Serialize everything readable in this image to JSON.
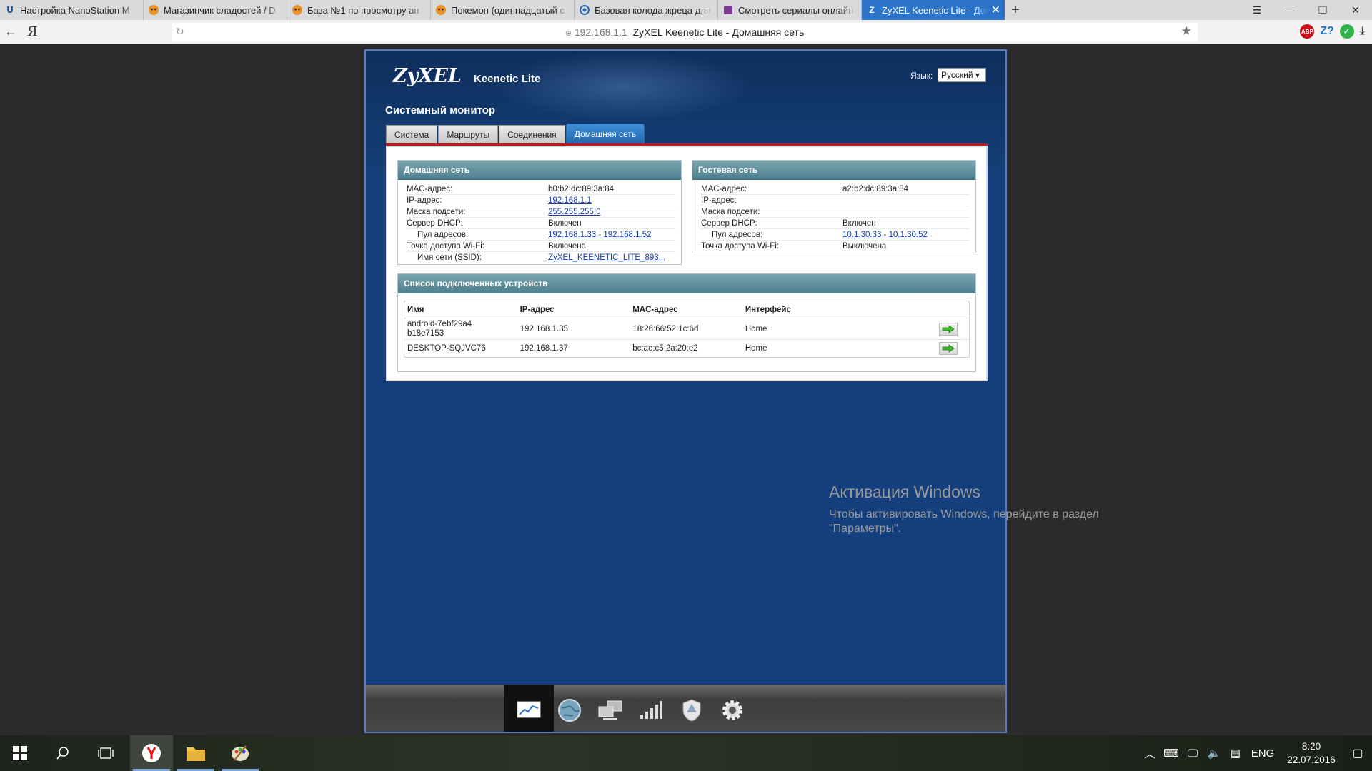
{
  "browser": {
    "tabs": [
      {
        "title": "Настройка NanoStation M",
        "favicon": "U"
      },
      {
        "title": "Магазинчик сладостей / D",
        "favicon": "tiger-icon"
      },
      {
        "title": "База №1 по просмотру ан",
        "favicon": "tiger-icon"
      },
      {
        "title": "Покемон (одиннадцатый с",
        "favicon": "tiger-icon"
      },
      {
        "title": "Базовая колода жреца для",
        "favicon": "swirl-icon"
      },
      {
        "title": "Смотреть сериалы онлайн",
        "favicon": "purple-icon"
      },
      {
        "title": "ZyXEL Keenetic Lite - Дом",
        "favicon": "Z"
      }
    ],
    "back_label": "←",
    "yandex_label": "Я",
    "url_host": "192.168.1.1",
    "url_title": "ZyXEL Keenetic Lite - Домашняя сеть",
    "ext_abp": "ABP",
    "ext_z": "Z?",
    "ext_ok": "✓"
  },
  "router": {
    "logo": "ZyXEL",
    "model": "Keenetic Lite",
    "lang_label": "Язык:",
    "lang_value": "Русский ▾",
    "page_title": "Системный монитор",
    "tabs": [
      "Система",
      "Маршруты",
      "Соединения",
      "Домашняя сеть"
    ],
    "active_tab": "Домашняя сеть",
    "home_net": {
      "title": "Домашняя сеть",
      "rows": [
        {
          "k": "MAC-адрес:",
          "v": "b0:b2:dc:89:3a:84"
        },
        {
          "k": "IP-адрес:",
          "v": "192.168.1.1"
        },
        {
          "k": "Маска подсети:",
          "v": "255.255.255.0"
        },
        {
          "k": "Сервер DHCP:",
          "v": "Включен"
        },
        {
          "k": "Пул адресов:",
          "v": "192.168.1.33 - 192.168.1.52"
        },
        {
          "k": "Точка доступа Wi-Fi:",
          "v": "Включена"
        },
        {
          "k": "Имя сети (SSID):",
          "v": "ZyXEL_KEENETIC_LITE_893..."
        }
      ]
    },
    "guest_net": {
      "title": "Гостевая сеть",
      "rows": [
        {
          "k": "MAC-адрес:",
          "v": "a2:b2:dc:89:3a:84"
        },
        {
          "k": "IP-адрес:",
          "v": ""
        },
        {
          "k": "Маска подсети:",
          "v": ""
        },
        {
          "k": "Сервер DHCP:",
          "v": "Включен"
        },
        {
          "k": "Пул адресов:",
          "v": "10.1.30.33 - 10.1.30.52"
        },
        {
          "k": "Точка доступа Wi-Fi:",
          "v": "Выключена"
        }
      ]
    },
    "devices": {
      "title": "Список подключенных устройств",
      "columns": [
        "Имя",
        "IP-адрес",
        "MAC-адрес",
        "Интерфейс"
      ],
      "rows": [
        {
          "name": "android-7ebf29a4b18e7153",
          "ip": "192.168.1.35",
          "mac": "18:26:66:52:1c:6d",
          "iface": "Home"
        },
        {
          "name": "DESKTOP-SQJVC76",
          "ip": "192.168.1.37",
          "mac": "bc:ae:c5:2a:20:e2",
          "iface": "Home"
        }
      ]
    },
    "toolbar": [
      "monitor-icon",
      "globe-icon",
      "network-icon",
      "signal-icon",
      "shield-icon",
      "gear-icon"
    ]
  },
  "watermark": {
    "line1": "Активация Windows",
    "line2": "Чтобы активировать Windows, перейдите в раздел",
    "line3": "\"Параметры\"."
  },
  "taskbar": {
    "lang": "ENG",
    "time": "8:20",
    "date": "22.07.2016"
  },
  "colors": {
    "accent": "#2c74c9",
    "router_bg": "#143f7c",
    "red_line": "#c4161c",
    "panel_head": "#5a8896"
  }
}
